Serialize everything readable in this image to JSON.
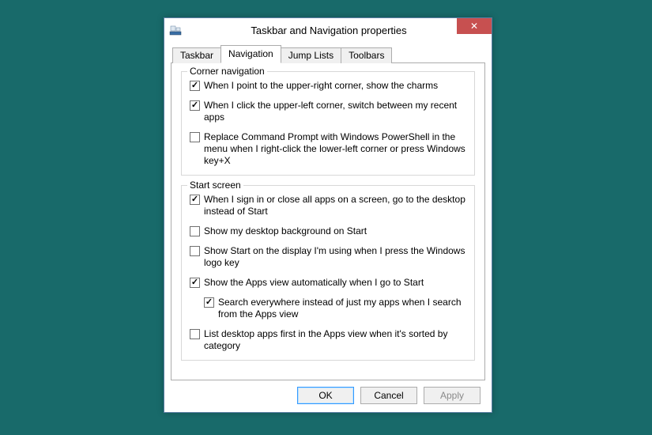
{
  "window": {
    "title": "Taskbar and Navigation properties"
  },
  "tabs": {
    "taskbar": "Taskbar",
    "navigation": "Navigation",
    "jumplists": "Jump Lists",
    "toolbars": "Toolbars"
  },
  "groups": {
    "corner": {
      "legend": "Corner navigation",
      "opt_charms": {
        "label": "When I point to the upper-right corner, show the charms",
        "checked": true
      },
      "opt_recent": {
        "label": "When I click the upper-left corner, switch between my recent apps",
        "checked": true
      },
      "opt_powershell": {
        "label": "Replace Command Prompt with Windows PowerShell in the menu when I right-click the lower-left corner or press Windows key+X",
        "checked": false
      }
    },
    "start": {
      "legend": "Start screen",
      "opt_desktop": {
        "label": "When I sign in or close all apps on a screen, go to the desktop instead of Start",
        "checked": true
      },
      "opt_bg": {
        "label": "Show my desktop background on Start",
        "checked": false
      },
      "opt_display": {
        "label": "Show Start on the display I'm using when I press the Windows logo key",
        "checked": false
      },
      "opt_appsview": {
        "label": "Show the Apps view automatically when I go to Start",
        "checked": true
      },
      "opt_search": {
        "label": "Search everywhere instead of just my apps when I search from the Apps view",
        "checked": true
      },
      "opt_listdesktop": {
        "label": "List desktop apps first in the Apps view when it's sorted by category",
        "checked": false
      }
    }
  },
  "buttons": {
    "ok": "OK",
    "cancel": "Cancel",
    "apply": "Apply"
  }
}
